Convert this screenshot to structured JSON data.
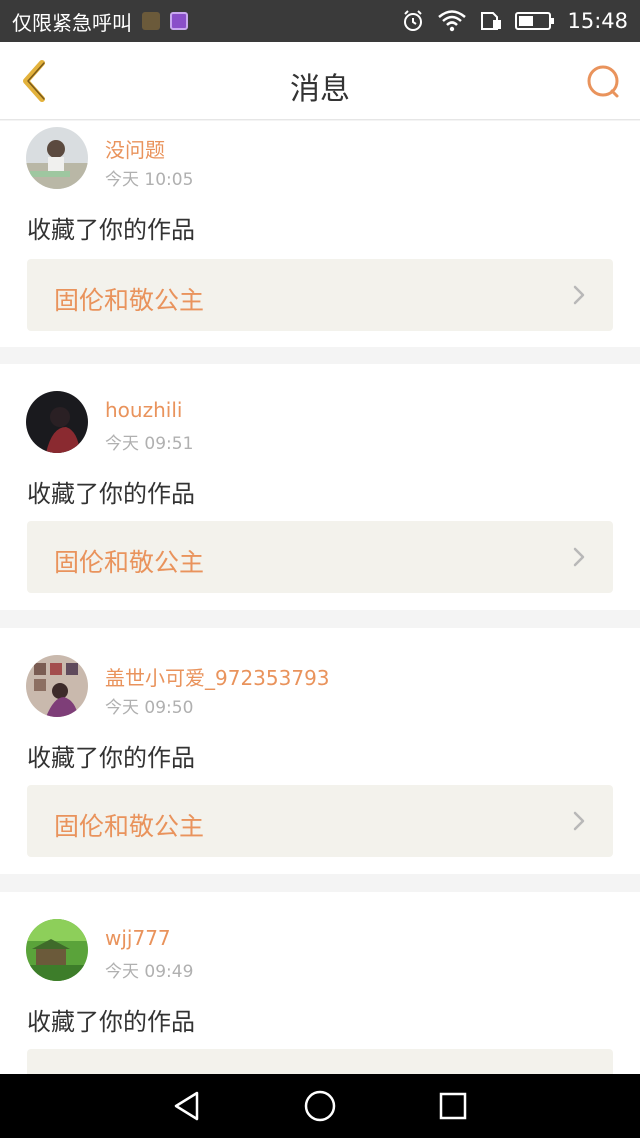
{
  "status_bar": {
    "carrier": "仅限紧急呼叫",
    "time": "15:48"
  },
  "header": {
    "title": "消息"
  },
  "messages": [
    {
      "username": "没问题",
      "time": "今天 10:05",
      "action": "收藏了你的作品",
      "work_title": "固伦和敬公主",
      "avatar": "avatar-photo"
    },
    {
      "username": "houzhili",
      "time": "今天 09:51",
      "action": "收藏了你的作品",
      "work_title": "固伦和敬公主",
      "avatar": "avatar-photo"
    },
    {
      "username": "盖世小可爱_972353793",
      "time": "今天 09:50",
      "action": "收藏了你的作品",
      "work_title": "固伦和敬公主",
      "avatar": "avatar-photo"
    },
    {
      "username": "wjj777",
      "time": "今天 09:49",
      "action": "收藏了你的作品",
      "work_title": "",
      "avatar": "avatar-photo"
    }
  ],
  "icons": {
    "back": "chevron-left-icon",
    "search": "search-icon",
    "chevron": "chevron-right-icon",
    "nav_back": "triangle-back-icon",
    "nav_home": "circle-home-icon",
    "nav_recent": "square-recent-icon"
  },
  "colors": {
    "accent": "#e9935c",
    "back_icon": "#e3b23c",
    "card_bg": "#ffffff",
    "work_bg": "#f3f2ec",
    "page_bg": "#f4f4f4",
    "status_bar": "#3a3a3a"
  }
}
